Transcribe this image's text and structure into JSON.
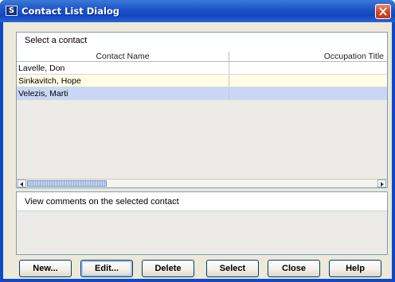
{
  "window": {
    "title": "Contact List Dialog",
    "icon": "app-icon-s",
    "icon_glyph": "S"
  },
  "top_panel": {
    "header": "Select a contact",
    "columns": [
      "Contact Name",
      "Occupation Title"
    ],
    "rows": [
      {
        "name": "Lavelle, Don",
        "occupation": "",
        "state": "normal"
      },
      {
        "name": "Sinkavitch, Hope",
        "occupation": "",
        "state": "alt"
      },
      {
        "name": "Velezis, Marti",
        "occupation": "",
        "state": "selected"
      }
    ],
    "scroll_position": 0
  },
  "bottom_panel": {
    "header": "View comments on the selected contact"
  },
  "buttons": {
    "new": "New...",
    "edit": "Edit...",
    "delete": "Delete",
    "select": "Select",
    "close": "Close",
    "help": "Help"
  },
  "colors": {
    "titlebar": "#1f55c9",
    "row_alt": "#fefde6",
    "row_selected": "#c9d6f6",
    "close_button": "#d5431d"
  }
}
